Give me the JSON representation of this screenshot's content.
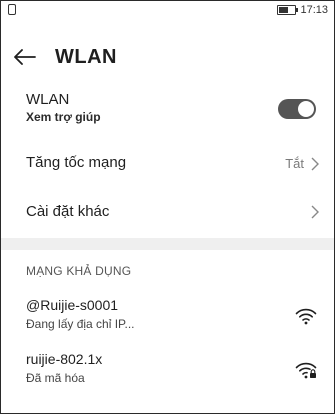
{
  "status": {
    "time": "17:13",
    "battery_level": 0.55
  },
  "header": {
    "title": "WLAN"
  },
  "wlan": {
    "label": "WLAN",
    "help": "Xem trợ giúp",
    "enabled": true
  },
  "speedup": {
    "label": "Tăng tốc mạng",
    "value": "Tắt"
  },
  "other": {
    "label": "Cài đặt khác"
  },
  "available": {
    "heading": "MẠNG KHẢ DỤNG",
    "networks": [
      {
        "name": "@Ruijie-s0001",
        "status": "Đang lấy địa chỉ IP...",
        "locked": false,
        "icon": "wifi-icon"
      },
      {
        "name": "ruijie-802.1x",
        "status": "Đã mã hóa",
        "locked": true,
        "icon": "wifi-lock-icon"
      }
    ]
  }
}
